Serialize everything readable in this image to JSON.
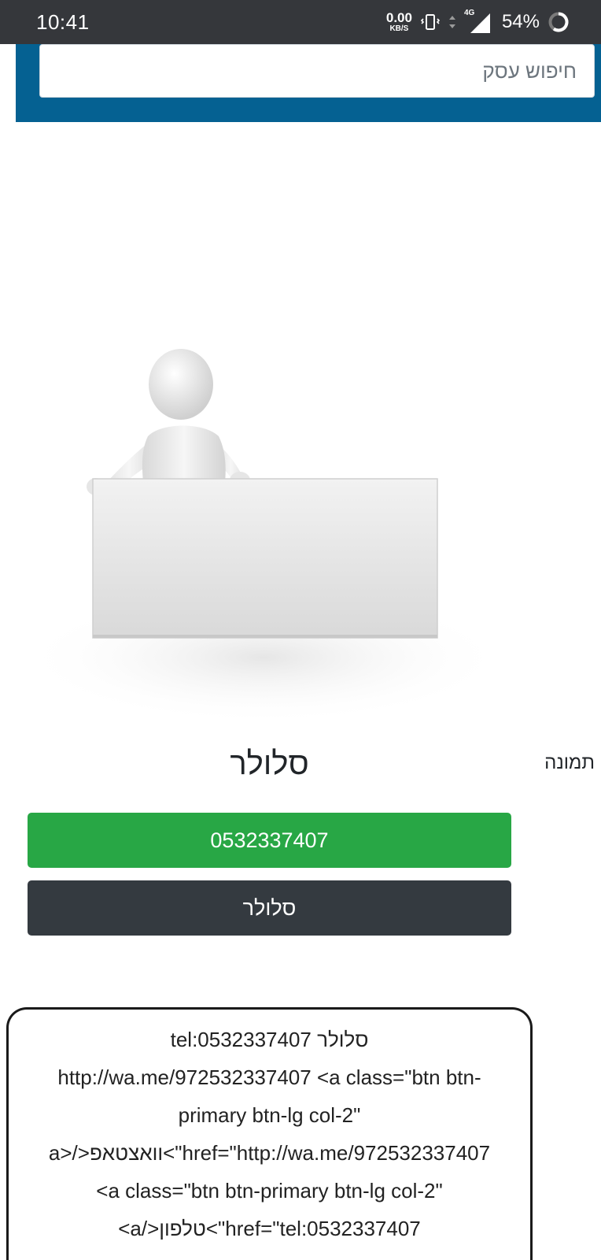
{
  "status_bar": {
    "time": "10:41",
    "net_speed_value": "0.00",
    "net_speed_unit": "KB/S",
    "network_type": "4G",
    "battery_percent": "54%",
    "icons": [
      "vibrate-icon",
      "data-arrows-icon",
      "signal-icon",
      "battery-ring-icon"
    ]
  },
  "header": {
    "search_placeholder": "חיפוש עסק",
    "band_color": "#056192"
  },
  "business": {
    "image_label": "תמונה",
    "name": "סלולר",
    "phone_button": "0532337407",
    "name_button": "סלולר"
  },
  "raw_output": {
    "lines": [
      "tel:0532337407 סלולר",
      "http://wa.me/972532337407 <a class=\"btn btn-",
      "primary btn-lg col-2\"",
      "a>/>וואצטאפ<\"href=\"http://wa.me/972532337407",
      "<a class=\"btn btn-primary btn-lg col-2\"",
      "<a/>טלפון<\"href=\"tel:0532337407"
    ]
  },
  "colors": {
    "status_bar": "#35373b",
    "phone_button": "#28a745",
    "name_button": "#343a40"
  }
}
